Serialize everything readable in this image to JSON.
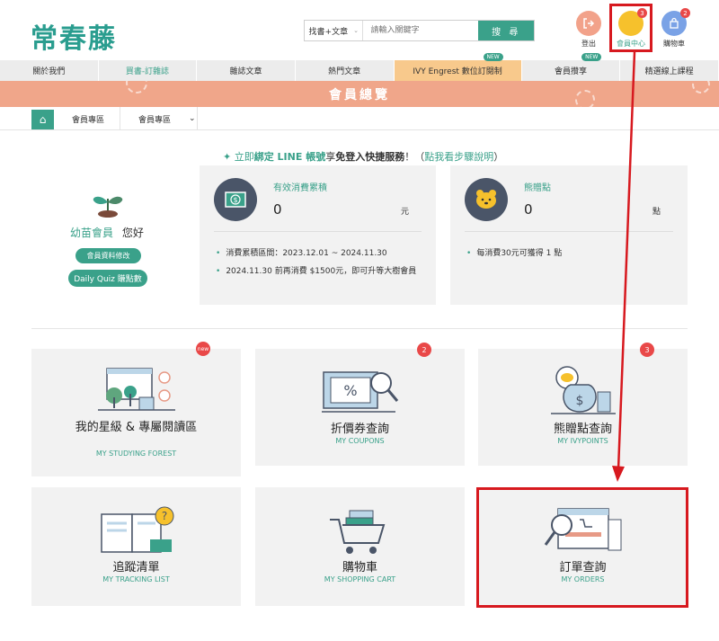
{
  "header": {
    "logo": "常春藤",
    "search": {
      "scope": "找書+文章",
      "placeholder": "請輸入關鍵字",
      "button": "搜 尋"
    },
    "icons": {
      "logout": "登出",
      "member_center": "會員中心",
      "member_badge": "3",
      "cart": "購物車",
      "cart_badge": "2"
    }
  },
  "nav": {
    "items": [
      {
        "label": "關於我們"
      },
      {
        "label": "買書-訂雜誌"
      },
      {
        "label": "雜誌文章"
      },
      {
        "label": "熱門文章"
      },
      {
        "label": "IVY Engrest 數位訂閱制",
        "badge": "NEW"
      },
      {
        "label": "會員攢享",
        "badge": "NEW"
      },
      {
        "label": "精選線上課程"
      }
    ]
  },
  "banner": {
    "title": "會員總覽"
  },
  "breadcrumb": {
    "seg1": "會員專區",
    "seg2": "會員專區"
  },
  "line_notice": {
    "prefix": "✦ 立即",
    "bind": "綁定 LINE 帳號",
    "mid": "享",
    "bold": "免登入快捷服務",
    "suffix": "！（",
    "link": "點我看步驟說明",
    "end": "）"
  },
  "member": {
    "level": "幼苗會員",
    "greeting": "您好",
    "edit_button": "會員資料修改",
    "quiz_button": "Daily Quiz 賺點數"
  },
  "summary": {
    "spend": {
      "label": "有效消費累積",
      "value": "0",
      "unit": "元",
      "notes": [
        "消費累積區間：2023.12.01 ~ 2024.11.30",
        "2024.11.30 前再消費 $1500元，即可升等大樹會員"
      ]
    },
    "points": {
      "label": "熊贈點",
      "value": "0",
      "unit": "點",
      "notes": [
        "每消費30元可獲得 1 點"
      ]
    }
  },
  "tiles": [
    {
      "title": "我的星級 & 專屬閱讀區",
      "sub": "MY STUDYING FOREST",
      "badge": "new"
    },
    {
      "title": "折價券查詢",
      "sub": "MY COUPONS",
      "badge": "2"
    },
    {
      "title": "熊贈點查詢",
      "sub": "MY IVYPOINTS",
      "badge": "3"
    },
    {
      "title": "追蹤清單",
      "sub": "MY TRACKING LIST"
    },
    {
      "title": "購物車",
      "sub": "MY SHOPPING CART"
    },
    {
      "title": "訂單查詢",
      "sub": "MY ORDERS"
    }
  ],
  "colors": {
    "accent": "#3aa18a",
    "banner": "#f0a68a",
    "highlight": "#d7191f",
    "badge": "#e94848"
  }
}
